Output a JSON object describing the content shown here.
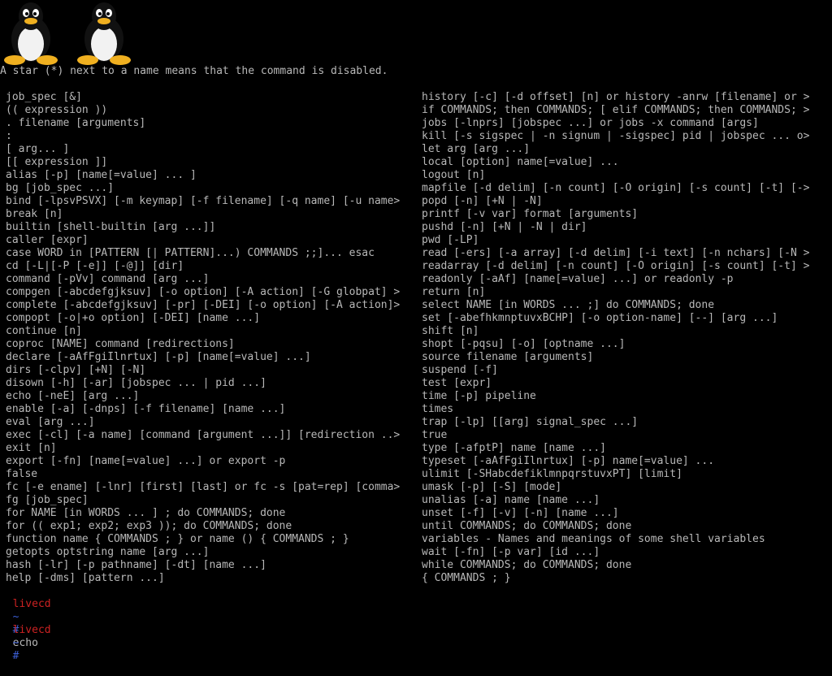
{
  "logos": [
    {
      "icon": "tux-penguin-icon"
    },
    {
      "icon": "tux-penguin-icon"
    }
  ],
  "header_text": "A star (*) next to a name means that the command is disabled.",
  "left_column": [
    "job_spec [&]",
    "(( expression ))",
    ". filename [arguments]",
    ":",
    "[ arg... ]",
    "[[ expression ]]",
    "alias [-p] [name[=value] ... ]",
    "bg [job_spec ...]",
    "bind [-lpsvPSVX] [-m keymap] [-f filename] [-q name] [-u name>",
    "break [n]",
    "builtin [shell-builtin [arg ...]]",
    "caller [expr]",
    "case WORD in [PATTERN [| PATTERN]...) COMMANDS ;;]... esac",
    "cd [-L|[-P [-e]] [-@]] [dir]",
    "command [-pVv] command [arg ...]",
    "compgen [-abcdefgjksuv] [-o option] [-A action] [-G globpat] >",
    "complete [-abcdefgjksuv] [-pr] [-DEI] [-o option] [-A action]>",
    "compopt [-o|+o option] [-DEI] [name ...]",
    "continue [n]",
    "coproc [NAME] command [redirections]",
    "declare [-aAfFgiIlnrtux] [-p] [name[=value] ...]",
    "dirs [-clpv] [+N] [-N]",
    "disown [-h] [-ar] [jobspec ... | pid ...]",
    "echo [-neE] [arg ...]",
    "enable [-a] [-dnps] [-f filename] [name ...]",
    "eval [arg ...]",
    "exec [-cl] [-a name] [command [argument ...]] [redirection ..>",
    "exit [n]",
    "export [-fn] [name[=value] ...] or export -p",
    "false",
    "fc [-e ename] [-lnr] [first] [last] or fc -s [pat=rep] [comma>",
    "fg [job_spec]",
    "for NAME [in WORDS ... ] ; do COMMANDS; done",
    "for (( exp1; exp2; exp3 )); do COMMANDS; done",
    "function name { COMMANDS ; } or name () { COMMANDS ; }",
    "getopts optstring name [arg ...]",
    "hash [-lr] [-p pathname] [-dt] [name ...]",
    "help [-dms] [pattern ...]"
  ],
  "right_column": [
    "history [-c] [-d offset] [n] or history -anrw [filename] or >",
    "if COMMANDS; then COMMANDS; [ elif COMMANDS; then COMMANDS; >",
    "jobs [-lnprs] [jobspec ...] or jobs -x command [args]",
    "kill [-s sigspec | -n signum | -sigspec] pid | jobspec ... o>",
    "let arg [arg ...]",
    "local [option] name[=value] ...",
    "logout [n]",
    "mapfile [-d delim] [-n count] [-O origin] [-s count] [-t] [->",
    "popd [-n] [+N | -N]",
    "printf [-v var] format [arguments]",
    "pushd [-n] [+N | -N | dir]",
    "pwd [-LP]",
    "read [-ers] [-a array] [-d delim] [-i text] [-n nchars] [-N >",
    "readarray [-d delim] [-n count] [-O origin] [-s count] [-t] >",
    "readonly [-aAf] [name[=value] ...] or readonly -p",
    "return [n]",
    "select NAME [in WORDS ... ;] do COMMANDS; done",
    "set [-abefhkmnptuvxBCHP] [-o option-name] [--] [arg ...]",
    "shift [n]",
    "shopt [-pqsu] [-o] [optname ...]",
    "source filename [arguments]",
    "suspend [-f]",
    "test [expr]",
    "time [-p] pipeline",
    "times",
    "trap [-lp] [[arg] signal_spec ...]",
    "true",
    "type [-afptP] name [name ...]",
    "typeset [-aAfFgiIlnrtux] [-p] name[=value] ...",
    "ulimit [-SHabcdefiklmnpqrstuvxPT] [limit]",
    "umask [-p] [-S] [mode]",
    "unalias [-a] name [name ...]",
    "unset [-f] [-v] [-n] [name ...]",
    "until COMMANDS; do COMMANDS; done",
    "variables - Names and meanings of some shell variables",
    "wait [-fn] [-p var] [id ...]",
    "while COMMANDS; do COMMANDS; done",
    "{ COMMANDS ; }"
  ],
  "prompts": [
    {
      "host": "livecd",
      "path": "~",
      "symbol": "#",
      "command": "echo"
    },
    {
      "host": "livecd",
      "path": "~",
      "symbol": "#",
      "command": ""
    }
  ],
  "colors": {
    "background": "#000000",
    "text": "#b8b8b8",
    "prompt_host": "#cc2222",
    "prompt_path": "#3c5fd6"
  }
}
